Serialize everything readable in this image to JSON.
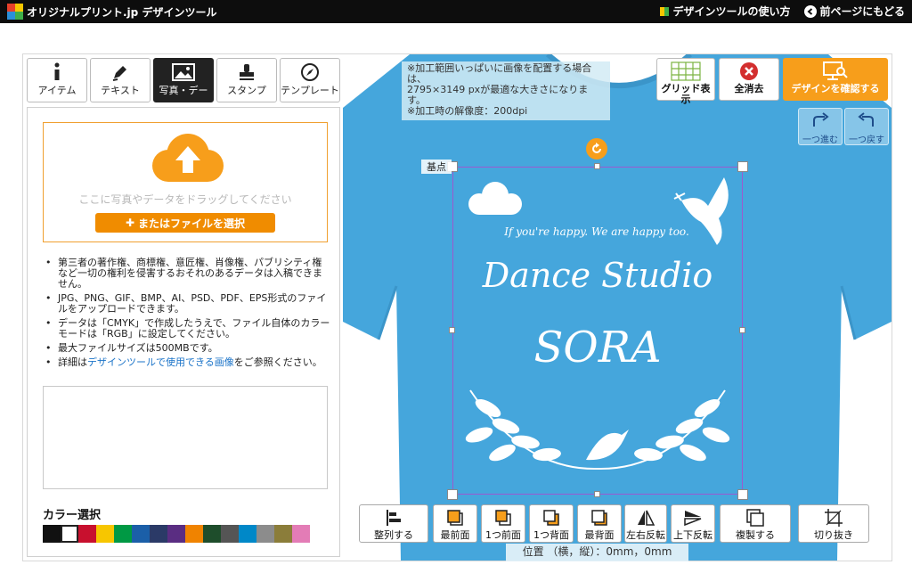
{
  "header": {
    "logo_text": "オリジナルプリント.jp デザインツール",
    "links": [
      {
        "label": "デザインツールの使い方"
      },
      {
        "label": "前ページにもどる"
      }
    ]
  },
  "tabs": [
    {
      "label": "アイテム",
      "icon": "info-icon"
    },
    {
      "label": "テキスト",
      "icon": "pen-icon"
    },
    {
      "label": "写真・デー",
      "icon": "image-icon",
      "active": true
    },
    {
      "label": "スタンプ",
      "icon": "stamp-icon"
    },
    {
      "label": "テンプレート",
      "icon": "compass-icon"
    }
  ],
  "upload": {
    "drop_text": "ここに写真やデータをドラッグしてください",
    "file_button": "またはファイルを選択"
  },
  "notes": [
    {
      "text": "第三者の著作権、商標権、意匠権、肖像権、パブリシティ権など一切の権利を侵害するおそれのあるデータは入稿できません。"
    },
    {
      "text": "JPG、PNG、GIF、BMP、AI、PSD、PDF、EPS形式のファイルをアップロードできます。"
    },
    {
      "text": "データは「CMYK」で作成したうえで、ファイル自体のカラーモードは「RGB」に設定してください。"
    },
    {
      "text": "最大ファイルサイズは500MBです。"
    },
    {
      "prefix": "詳細は",
      "link": "デザインツールで使用できる画像",
      "suffix": "をご参照ください。"
    }
  ],
  "color_select": {
    "title": "カラー選択",
    "colors": [
      "#111111",
      "#ffffff",
      "#c8102e",
      "#f7c600",
      "#009944",
      "#1b5fa8",
      "#2b3a67",
      "#5a2d82",
      "#f08300",
      "#1e4d2b",
      "#555555",
      "#0088c8",
      "#8c8c8c",
      "#8b7d3a",
      "#e37cb6"
    ]
  },
  "info": {
    "lines": [
      "※加工範囲いっぱいに画像を配置する場合は、",
      "2795×3149 pxが最適な大きさになります。",
      "※加工時の解像度：200dpi"
    ]
  },
  "toolbar": {
    "grid": "グリッド表示",
    "clear": "全消去",
    "confirm": "デザインを確認する",
    "redo": "一つ進む",
    "undo": "一つ戻す"
  },
  "canvas": {
    "base_point": "基点",
    "shirt_color": "#45a6dc",
    "design": {
      "tagline": "If you're happy. We are happy too.",
      "title": "Dance Studio",
      "subtitle": "SORA"
    }
  },
  "bottom_bar": [
    {
      "label": "整列する",
      "icon": "align-icon"
    },
    {
      "label": "最前面",
      "icon": "bring-front-icon"
    },
    {
      "label": "1つ前面",
      "icon": "bring-forward-icon"
    },
    {
      "label": "1つ背面",
      "icon": "send-backward-icon"
    },
    {
      "label": "最背面",
      "icon": "send-back-icon"
    },
    {
      "label": "左右反転",
      "icon": "flip-horizontal-icon"
    },
    {
      "label": "上下反転",
      "icon": "flip-vertical-icon"
    },
    {
      "label": "複製する",
      "icon": "duplicate-icon"
    },
    {
      "label": "切り抜き",
      "icon": "crop-icon"
    }
  ],
  "position": {
    "text": "位置 （横，縦）：0mm，0mm"
  }
}
